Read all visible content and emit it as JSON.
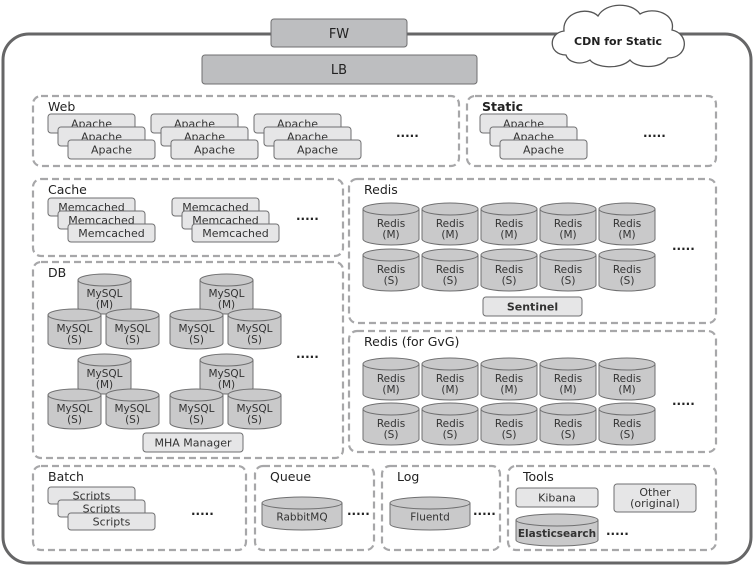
{
  "top": {
    "fw": "FW",
    "lb": "LB",
    "cdn": "CDN for Static"
  },
  "groups": {
    "web": {
      "label": "Web",
      "item": "Apache",
      "more": "....."
    },
    "static": {
      "label": "Static",
      "item": "Apache",
      "more": "....."
    },
    "cache": {
      "label": "Cache",
      "item": "Memcached",
      "more": "....."
    },
    "redis": {
      "label": "Redis",
      "master": [
        "Redis",
        "(M)"
      ],
      "slave": [
        "Redis",
        "(S)"
      ],
      "sentinel": "Sentinel",
      "more": "....."
    },
    "db": {
      "label": "DB",
      "master": [
        "MySQL",
        "(M)"
      ],
      "slave": [
        "MySQL",
        "(S)"
      ],
      "manager": "MHA Manager",
      "more": "....."
    },
    "redis_gvg": {
      "label": "Redis (for GvG)",
      "master": [
        "Redis",
        "(M)"
      ],
      "slave": [
        "Redis",
        "(S)"
      ],
      "more": "....."
    },
    "batch": {
      "label": "Batch",
      "item": "Scripts",
      "more": "....."
    },
    "queue": {
      "label": "Queue",
      "item": "RabbitMQ",
      "more": "....."
    },
    "log": {
      "label": "Log",
      "item": "Fluentd",
      "more": "....."
    },
    "tools": {
      "label": "Tools",
      "kibana": "Kibana",
      "other": [
        "Other",
        "(original)"
      ],
      "elasticsearch": "Elasticsearch",
      "more": "....."
    }
  },
  "colors": {
    "frame": "#666667",
    "topbox": "#bdbec0",
    "box": "#e6e6e7",
    "cylinder": "#c9c9ca",
    "dashed": "#a7a7a9"
  }
}
